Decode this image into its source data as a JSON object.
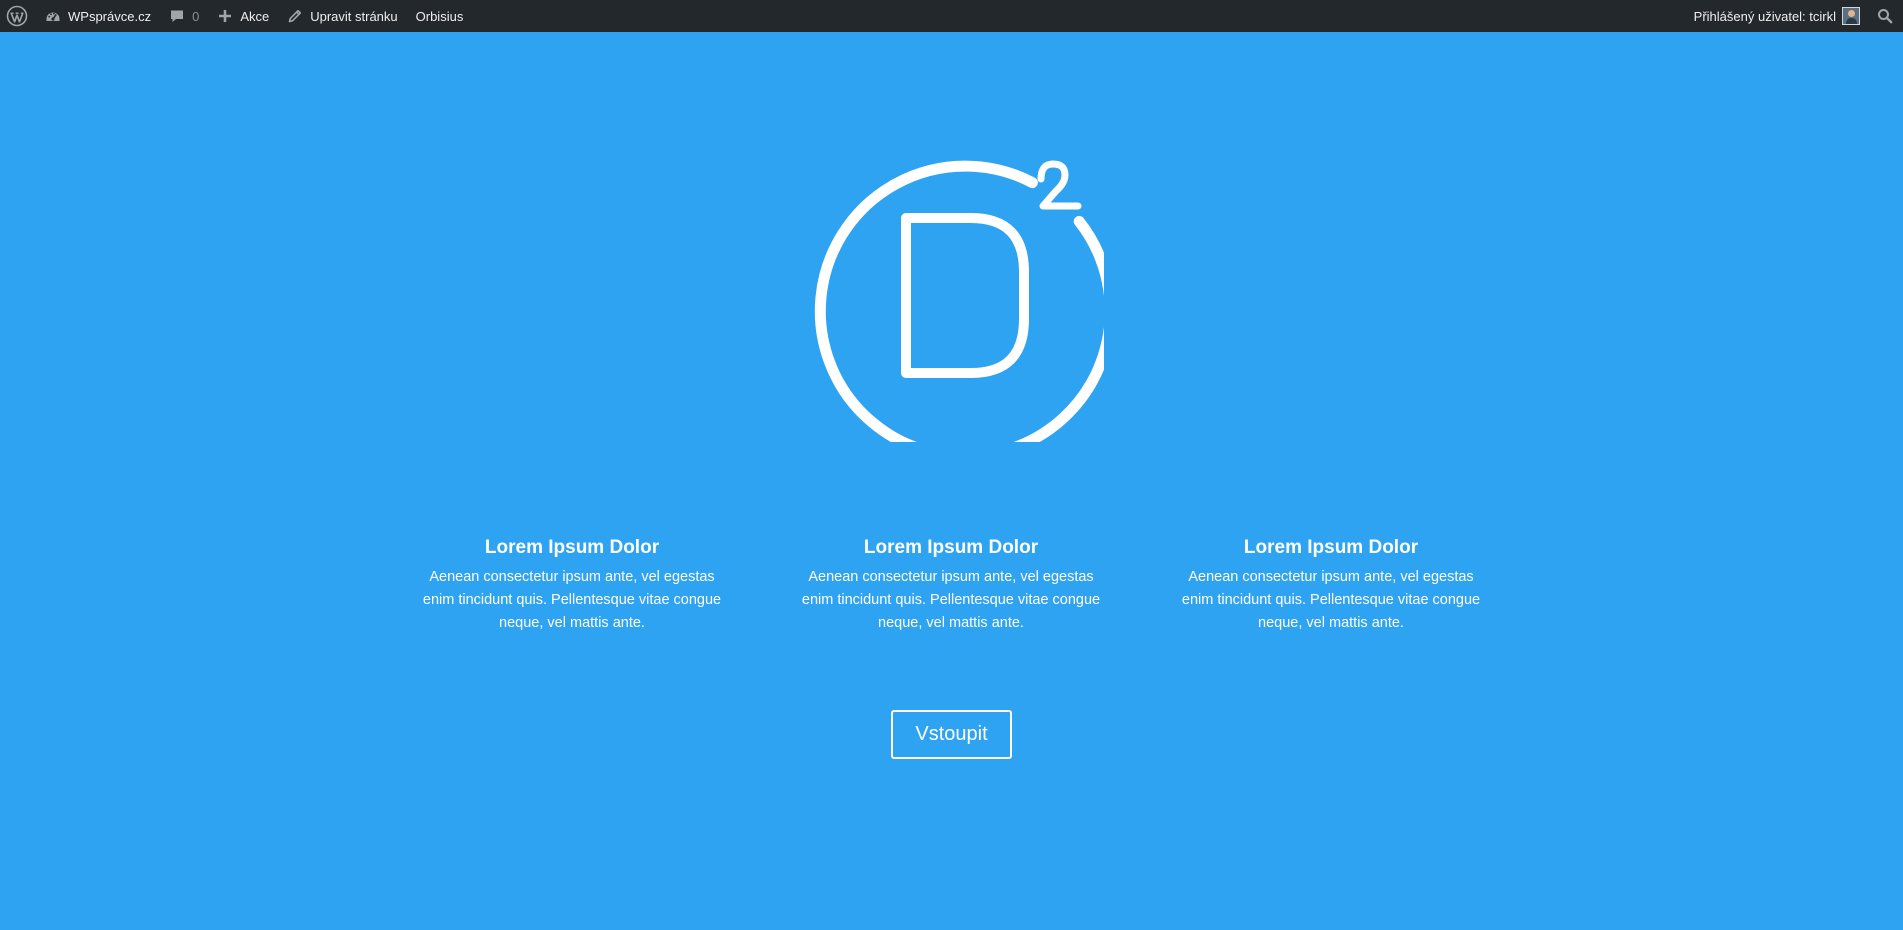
{
  "adminbar": {
    "wp_logo_icon": "wordpress-icon",
    "site_name": "WPsprávce.cz",
    "site_icon": "dashboard-gauge-icon",
    "comments_icon": "comment-bubble-icon",
    "comments_count": "0",
    "new_icon": "plus-icon",
    "new_label": "Akce",
    "edit_icon": "pencil-icon",
    "edit_label": "Upravit stránku",
    "plugin_label": "Orbisius",
    "account_label": "Přihlášený uživatel: tcirkl",
    "search_icon": "search-icon",
    "background_color": "#23282d"
  },
  "hero": {
    "background_color": "#2ea3f2",
    "logo_icon": "divi-d-squared-logo-icon",
    "features": [
      {
        "title": "Lorem Ipsum Dolor",
        "text": "Aenean consectetur ipsum ante, vel egestas enim tincidunt quis. Pellentesque vitae congue neque, vel mattis ante."
      },
      {
        "title": "Lorem Ipsum Dolor",
        "text": "Aenean consectetur ipsum ante, vel egestas enim tincidunt quis. Pellentesque vitae congue neque, vel mattis ante."
      },
      {
        "title": "Lorem Ipsum Dolor",
        "text": "Aenean consectetur ipsum ante, vel egestas enim tincidunt quis. Pellentesque vitae congue neque, vel mattis ante."
      }
    ],
    "cta_label": "Vstoupit"
  }
}
